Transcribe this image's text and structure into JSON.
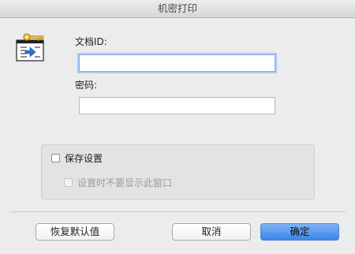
{
  "window": {
    "title": "机密打印"
  },
  "form": {
    "doc_id_label": "文档ID:",
    "doc_id_value": "",
    "password_label": "密码:",
    "password_value": ""
  },
  "options": {
    "save_settings_label": "保存设置",
    "save_settings_checked": false,
    "dont_show_label": "设置时不要显示此窗口",
    "dont_show_checked": false,
    "dont_show_enabled": false
  },
  "buttons": {
    "restore_defaults": "恢复默认值",
    "cancel": "取消",
    "ok": "确定"
  },
  "icons": {
    "document": "key-document-icon"
  },
  "colors": {
    "accent": "#3b86ea",
    "focus_ring": "#a9cbf4"
  }
}
